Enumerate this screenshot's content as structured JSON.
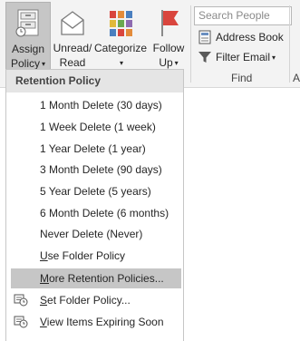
{
  "ribbon": {
    "assign_policy": {
      "line1": "Assign",
      "line2": "Policy",
      "caret": "▾"
    },
    "unread_read": {
      "line1": "Unread/",
      "line2": "Read"
    },
    "categorize": {
      "line1": "Categorize",
      "caret": "▾"
    },
    "follow_up": {
      "line1": "Follow",
      "line2": "Up",
      "caret": "▾"
    },
    "search": {
      "placeholder": "Search People"
    },
    "address_book": {
      "label": "Address Book"
    },
    "filter_email": {
      "label": "Filter Email",
      "caret": "▾"
    },
    "group_find": "Find",
    "group_a": "A"
  },
  "menu": {
    "header": "Retention Policy",
    "items": [
      {
        "label": "1 Month Delete (30 days)"
      },
      {
        "label": "1 Week Delete (1 week)"
      },
      {
        "label": "1 Year Delete (1 year)"
      },
      {
        "label": "3 Month Delete (90 days)"
      },
      {
        "label": "5 Year Delete (5 years)"
      },
      {
        "label": "6 Month Delete (6 months)"
      },
      {
        "label": "Never Delete (Never)"
      },
      {
        "label_first": "U",
        "label_rest": "se Folder Policy"
      },
      {
        "label_first": "M",
        "label_rest": "ore Retention Policies...",
        "highlighted": true
      },
      {
        "label_first": "S",
        "label_rest": "et Folder Policy...",
        "icon": "policy-clock-icon"
      },
      {
        "label_first": "V",
        "label_rest": "iew Items Expiring Soon",
        "icon": "policy-clock-icon"
      }
    ]
  },
  "colors": {
    "ribbon_bg": "#f3f3f3",
    "pressed_button": "#c6c6c6",
    "menu_header_bg": "#e5e5e5",
    "menu_highlight": "#c6c6c6",
    "flag_red": "#d9453d",
    "envelope_grey": "#7a7a7a",
    "categorize_red": "#d9453d",
    "categorize_orange": "#e38b3a",
    "categorize_blue": "#4a7fbf",
    "categorize_yellow": "#e0b93a",
    "categorize_green": "#6aa84f",
    "categorize_purple": "#8e6bb0"
  }
}
